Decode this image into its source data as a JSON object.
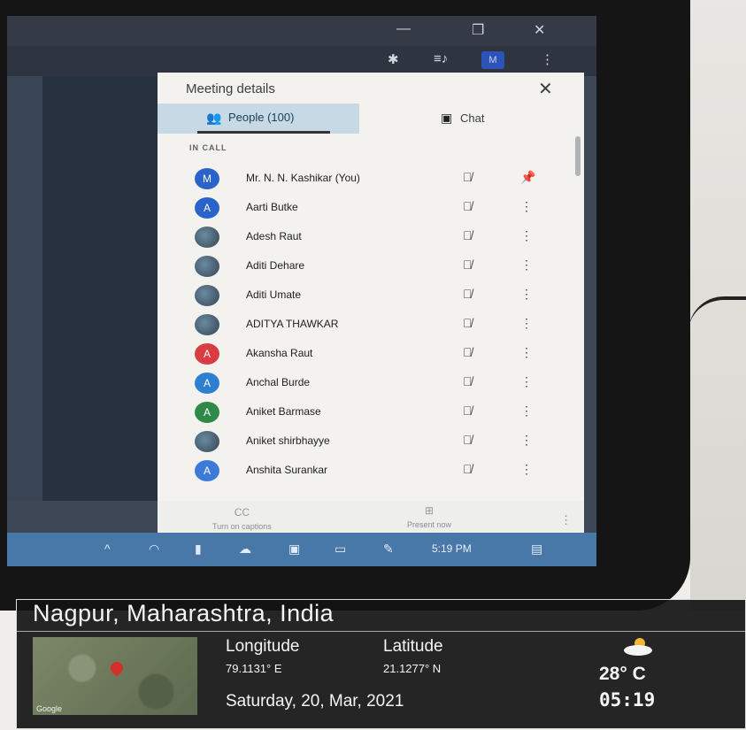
{
  "window": {
    "minimize_icon": "—",
    "maximize_icon": "❐",
    "close_icon": "✕"
  },
  "toolbar": {
    "extensions_icon": "✱",
    "queue_icon": "≡♪",
    "profile_initial": "M",
    "menu_icon": "⋮"
  },
  "panel": {
    "title": "Meeting details",
    "close_icon": "✕",
    "tabs": [
      {
        "label": "People (100)",
        "icon": "👥"
      },
      {
        "label": "Chat",
        "icon": "▣"
      }
    ],
    "section_label": "IN CALL",
    "participants": [
      {
        "name": "Mr. N. N. Kashikar (You)",
        "initial": "M",
        "color": "#2a63c9",
        "action": "📌"
      },
      {
        "name": "Aarti Butke",
        "initial": "A",
        "color": "#2a63c9",
        "action": "⋮"
      },
      {
        "name": "Adesh Raut",
        "initial": "",
        "color": "",
        "action": "⋮"
      },
      {
        "name": "Aditi Dehare",
        "initial": "",
        "color": "",
        "action": "⋮"
      },
      {
        "name": "Aditi Umate",
        "initial": "",
        "color": "",
        "action": "⋮"
      },
      {
        "name": "ADITYA THAWKAR",
        "initial": "",
        "color": "",
        "action": "⋮"
      },
      {
        "name": "Akansha Raut",
        "initial": "A",
        "color": "#d93c43",
        "action": "⋮"
      },
      {
        "name": "Anchal Burde",
        "initial": "A",
        "color": "#2e7fd0",
        "action": "⋮"
      },
      {
        "name": "Aniket Barmase",
        "initial": "A",
        "color": "#2f8a48",
        "action": "⋮"
      },
      {
        "name": "Aniket shirbhayye",
        "initial": "",
        "color": "",
        "action": "⋮"
      },
      {
        "name": "Anshita Surankar",
        "initial": "A",
        "color": "#3c7ad8",
        "action": "⋮"
      }
    ],
    "mute_icon": "🎙̸"
  },
  "controls": {
    "captions_label": "Turn on captions",
    "captions_icon": "CC",
    "present_label": "Present now",
    "present_icon": "⊞",
    "more_icon": "⋮"
  },
  "taskbar": {
    "time": "5:19 PM",
    "notification_icon": "▤"
  },
  "overlay": {
    "location": "Nagpur, Maharashtra, India",
    "longitude_label": "Longitude",
    "latitude_label": "Latitude",
    "longitude": "79.1131° E",
    "latitude": "21.1277° N",
    "date": "Saturday, 20, Mar, 2021",
    "temperature": "28° C",
    "time": "05:19",
    "map_brand": "Google"
  }
}
